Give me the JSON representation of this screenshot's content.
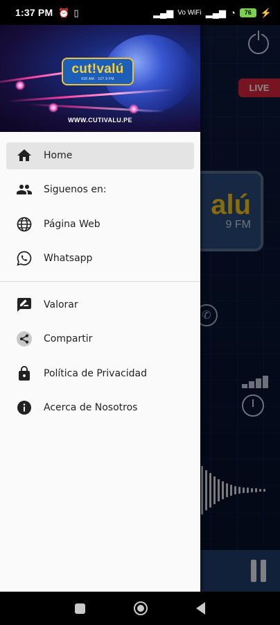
{
  "status_bar": {
    "time": "1:37 PM",
    "alarm_icon": "alarm-icon",
    "notification_icon": "notification-icon",
    "signal_icons": [
      "signal-1-icon",
      "volte-icon",
      "signal-2-icon",
      "wifi-icon"
    ],
    "vowifi_label": "Vo WiFi",
    "battery_level": "76",
    "charging_icon": "bolt-icon"
  },
  "player": {
    "live_badge": "LIVE",
    "logo_text": "alú",
    "logo_sub": "9 FM"
  },
  "drawer": {
    "brand_name": "cut!valú",
    "brand_freq": "630 AM · 107.9 FM",
    "brand_url": "WWW.CUTIVALU.PE",
    "items": [
      {
        "label": "Home",
        "icon": "home-icon",
        "active": true
      },
      {
        "label": "Siguenos en:",
        "icon": "people-icon",
        "active": false
      },
      {
        "label": "Página Web",
        "icon": "globe-icon",
        "active": false
      },
      {
        "label": "Whatsapp",
        "icon": "whatsapp-icon",
        "active": false
      }
    ],
    "items_secondary": [
      {
        "label": "Valorar",
        "icon": "rate-review-icon"
      },
      {
        "label": "Compartir",
        "icon": "share-icon"
      },
      {
        "label": "Política de Privacidad",
        "icon": "lock-icon"
      },
      {
        "label": "Acerca de Nosotros",
        "icon": "info-icon"
      }
    ]
  },
  "colors": {
    "drawer_bg": "#fafafa",
    "active_item_bg": "#e4e4e4",
    "live_red": "#d7263d",
    "brand_yellow": "#f7d13a",
    "brand_blue": "#1d5fb8"
  }
}
